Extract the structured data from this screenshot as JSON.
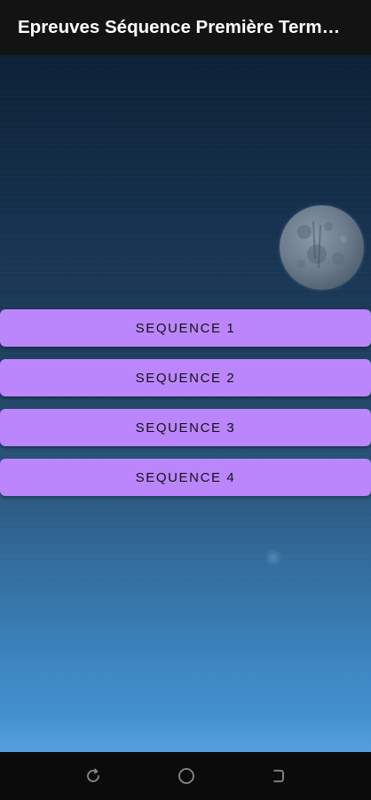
{
  "app_bar": {
    "title": "Epreuves Séquence Première Terminale C D E"
  },
  "buttons": [
    {
      "label": "SEQUENCE 1"
    },
    {
      "label": "SEQUENCE 2"
    },
    {
      "label": "SEQUENCE 3"
    },
    {
      "label": "SEQUENCE 4"
    }
  ],
  "colors": {
    "app_bar_background": "#131313",
    "button_background": "#bb86fc",
    "button_text": "#121212",
    "sky_top": "#0c2136",
    "sky_bottom": "#4696d6",
    "nav_bar_background": "#0b0b0b"
  },
  "navigation_bar": {
    "icons": [
      "recent-apps-icon",
      "home-icon",
      "back-icon"
    ]
  }
}
